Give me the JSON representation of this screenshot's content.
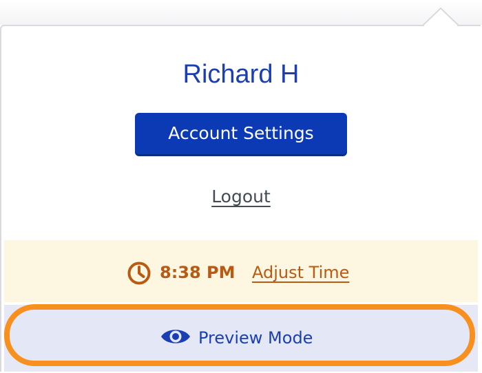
{
  "user": {
    "name": "Richard H"
  },
  "menu": {
    "account_settings_label": "Account Settings",
    "logout_label": "Logout"
  },
  "time": {
    "current": "8:38 PM",
    "adjust_label": "Adjust Time",
    "icon": "clock-icon"
  },
  "preview": {
    "label": "Preview Mode",
    "icon": "eye-icon"
  },
  "colors": {
    "primary_blue": "#0c3ab4",
    "name_blue": "#1a3fb3",
    "time_orange": "#b85a12",
    "time_bar_bg": "#fdf6e0",
    "preview_bg": "#e4e8f6",
    "focus_ring": "#f7901e"
  }
}
